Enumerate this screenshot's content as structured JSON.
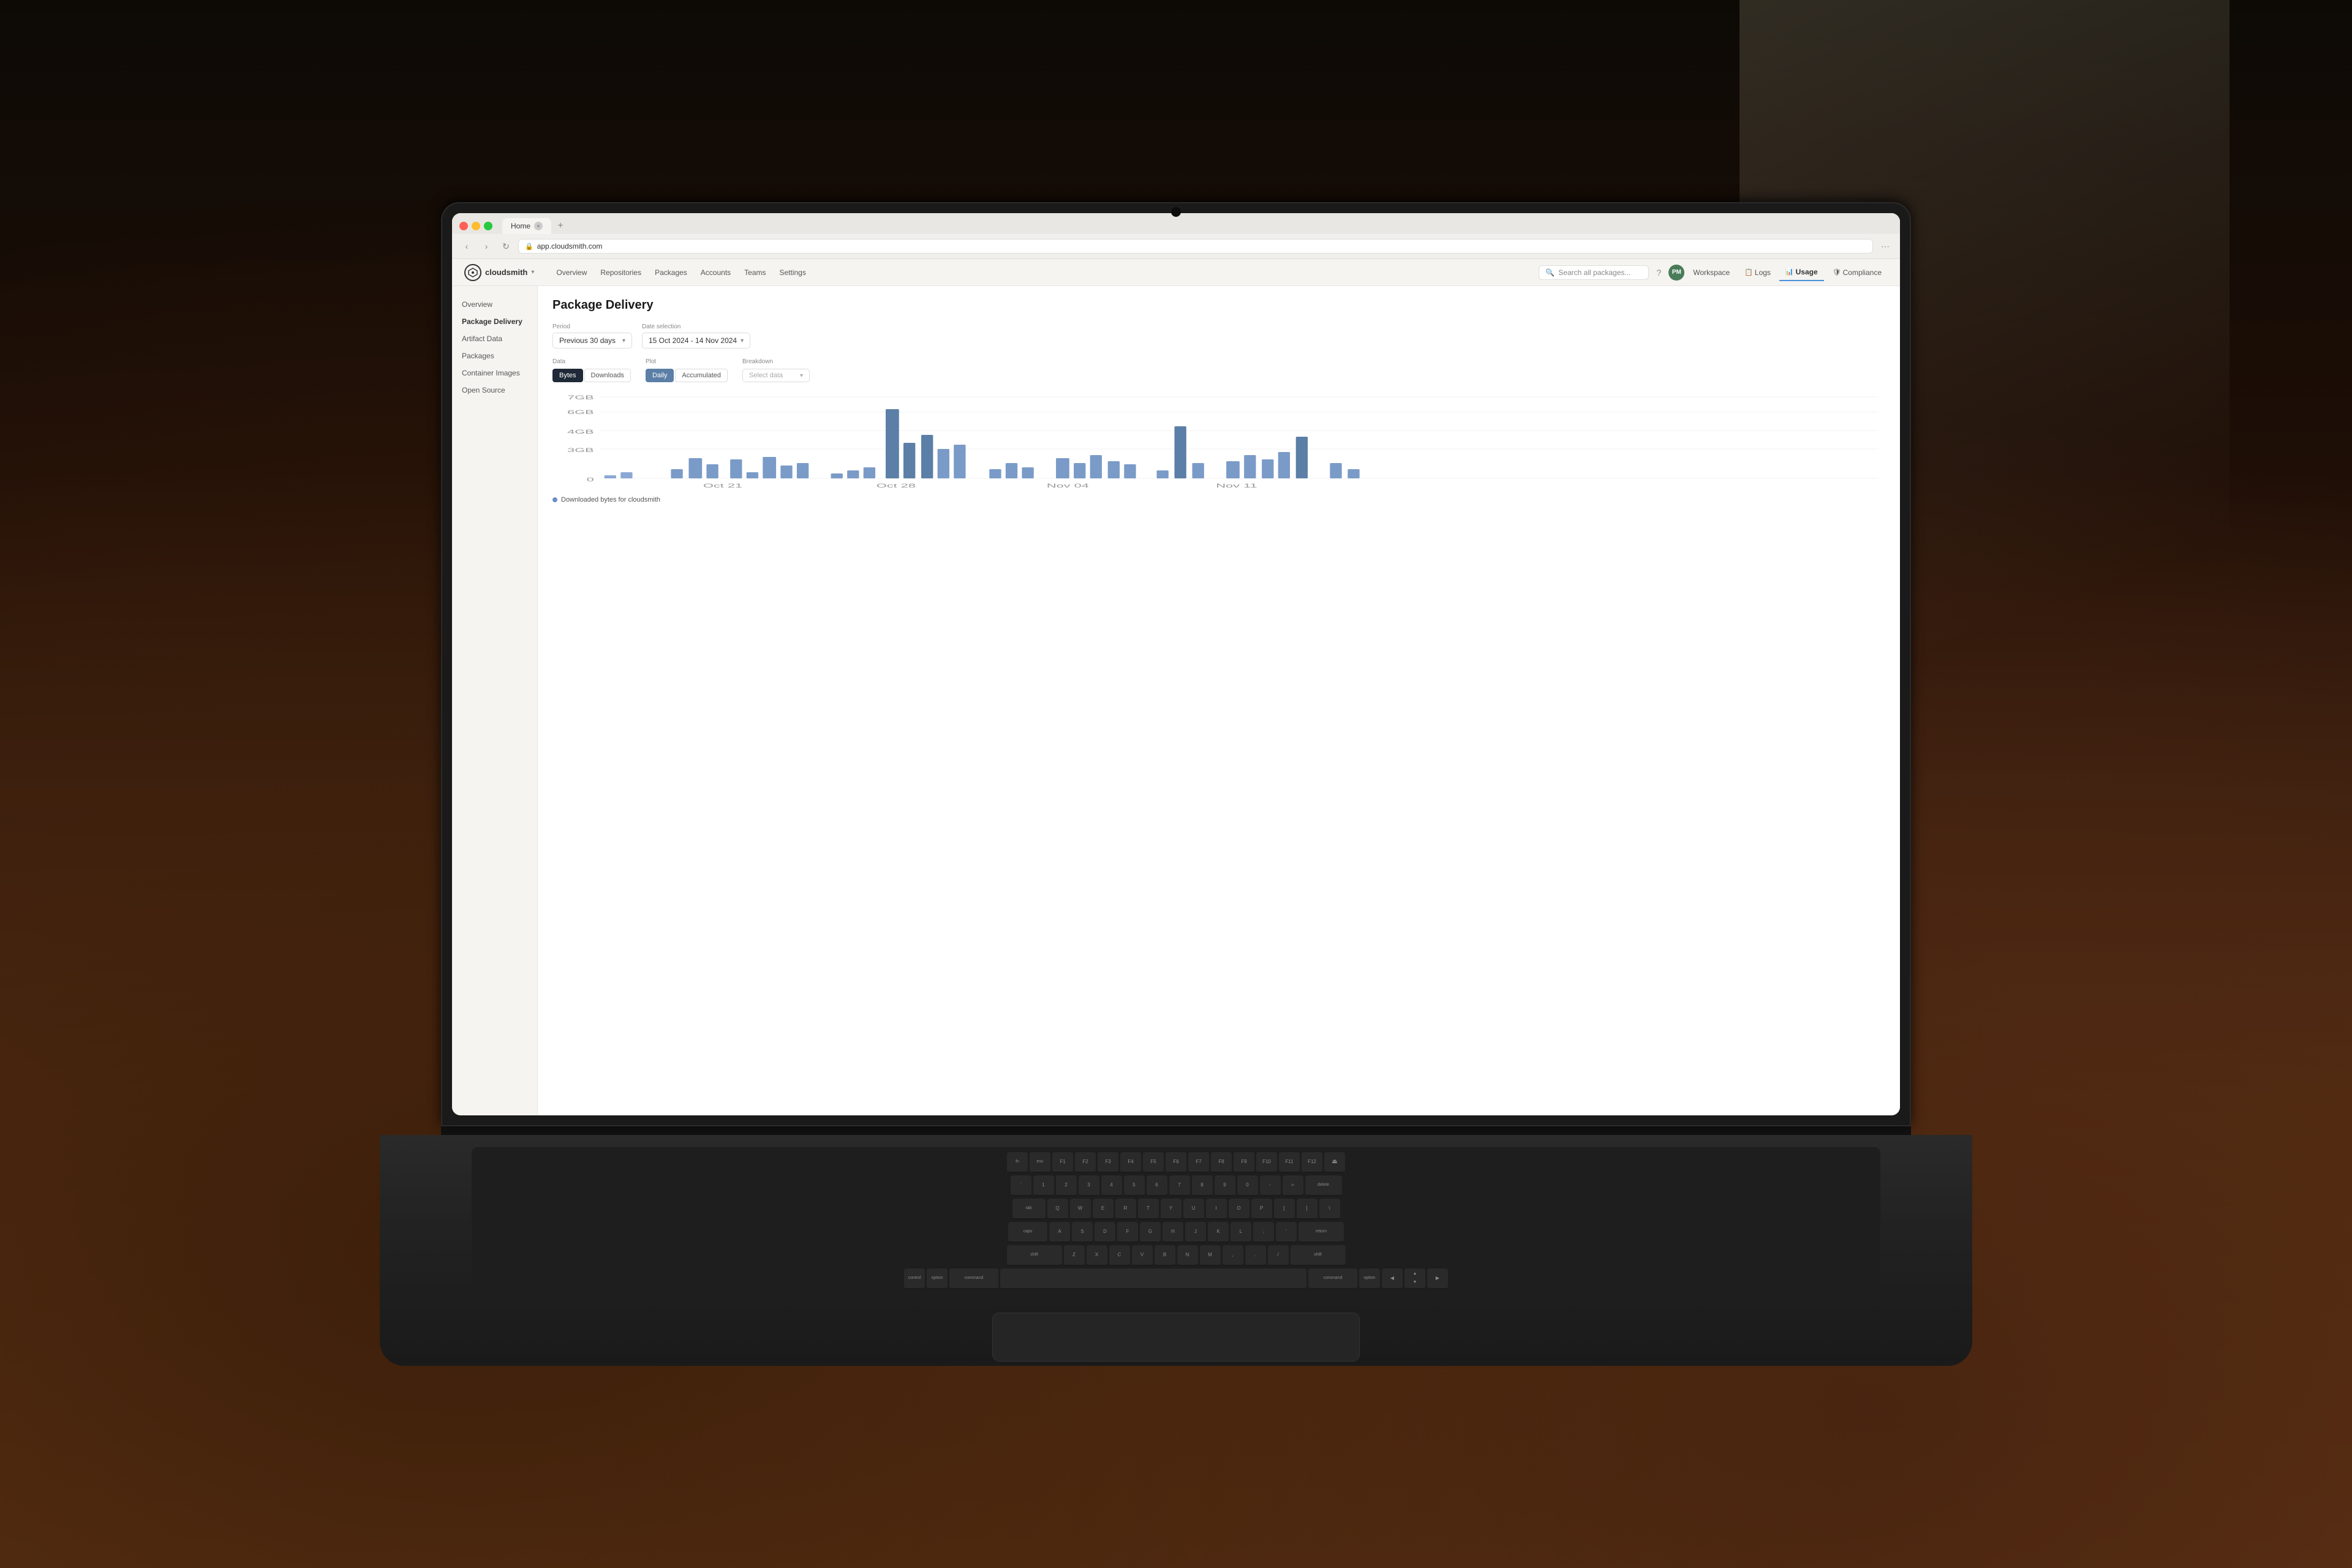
{
  "browser": {
    "tab_title": "Home",
    "url": "app.cloudsmith.com",
    "new_tab_symbol": "+"
  },
  "nav": {
    "logo_text": "CS",
    "org_name": "cloudsmith",
    "main_items": [
      "Overview",
      "Repositories",
      "Packages",
      "Accounts",
      "Teams",
      "Settings"
    ],
    "right_items": [
      "Workspace",
      "Logs",
      "Usage",
      "Compliance"
    ],
    "active_item": "Usage",
    "search_placeholder": "Search all packages...",
    "avatar_initials": "PM"
  },
  "sidebar": {
    "items": [
      "Overview",
      "Package Delivery",
      "Artifact Data",
      "Packages",
      "Container Images",
      "Open Source"
    ]
  },
  "page": {
    "title": "Package Delivery",
    "period_label": "Period",
    "period_value": "Previous 30 days",
    "date_label": "Date selection",
    "date_value": "15 Oct 2024 - 14 Nov 2024",
    "data_label": "Data",
    "plot_label": "Plot",
    "breakdown_label": "Breakdown",
    "btn_bytes": "Bytes",
    "btn_downloads": "Downloads",
    "btn_daily": "Daily",
    "btn_accumulated": "Accumulated",
    "breakdown_placeholder": "Select data",
    "legend_text": "Downloaded bytes for cloudsmith",
    "chart_labels": [
      "Oct 21",
      "Oct 28",
      "Nov 04",
      "Nov 11"
    ],
    "y_axis": [
      "7GB",
      "6GB",
      "4GB",
      "3GB",
      "0"
    ]
  }
}
